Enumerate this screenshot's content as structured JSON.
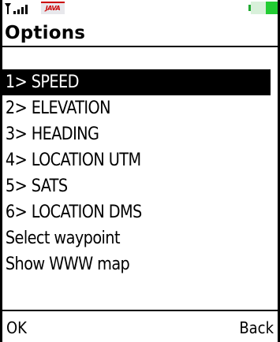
{
  "status_bar": {
    "signal_icon": "signal-strength-icon",
    "java_icon": "java-icon",
    "java_label": "JAVA",
    "battery_icon": "battery-icon",
    "battery_level": 0.45,
    "battery_color": "#22cc33"
  },
  "title": "Options",
  "menu": {
    "items": [
      {
        "label": "1> SPEED",
        "selected": true
      },
      {
        "label": "2> ELEVATION",
        "selected": false
      },
      {
        "label": "3> HEADING",
        "selected": false
      },
      {
        "label": "4> LOCATION UTM",
        "selected": false
      },
      {
        "label": "5> SATS",
        "selected": false
      },
      {
        "label": "6> LOCATION DMS",
        "selected": false
      },
      {
        "label": "Select waypoint",
        "selected": false
      },
      {
        "label": "Show WWW map",
        "selected": false
      }
    ]
  },
  "softkeys": {
    "left": "OK",
    "right": "Back"
  }
}
